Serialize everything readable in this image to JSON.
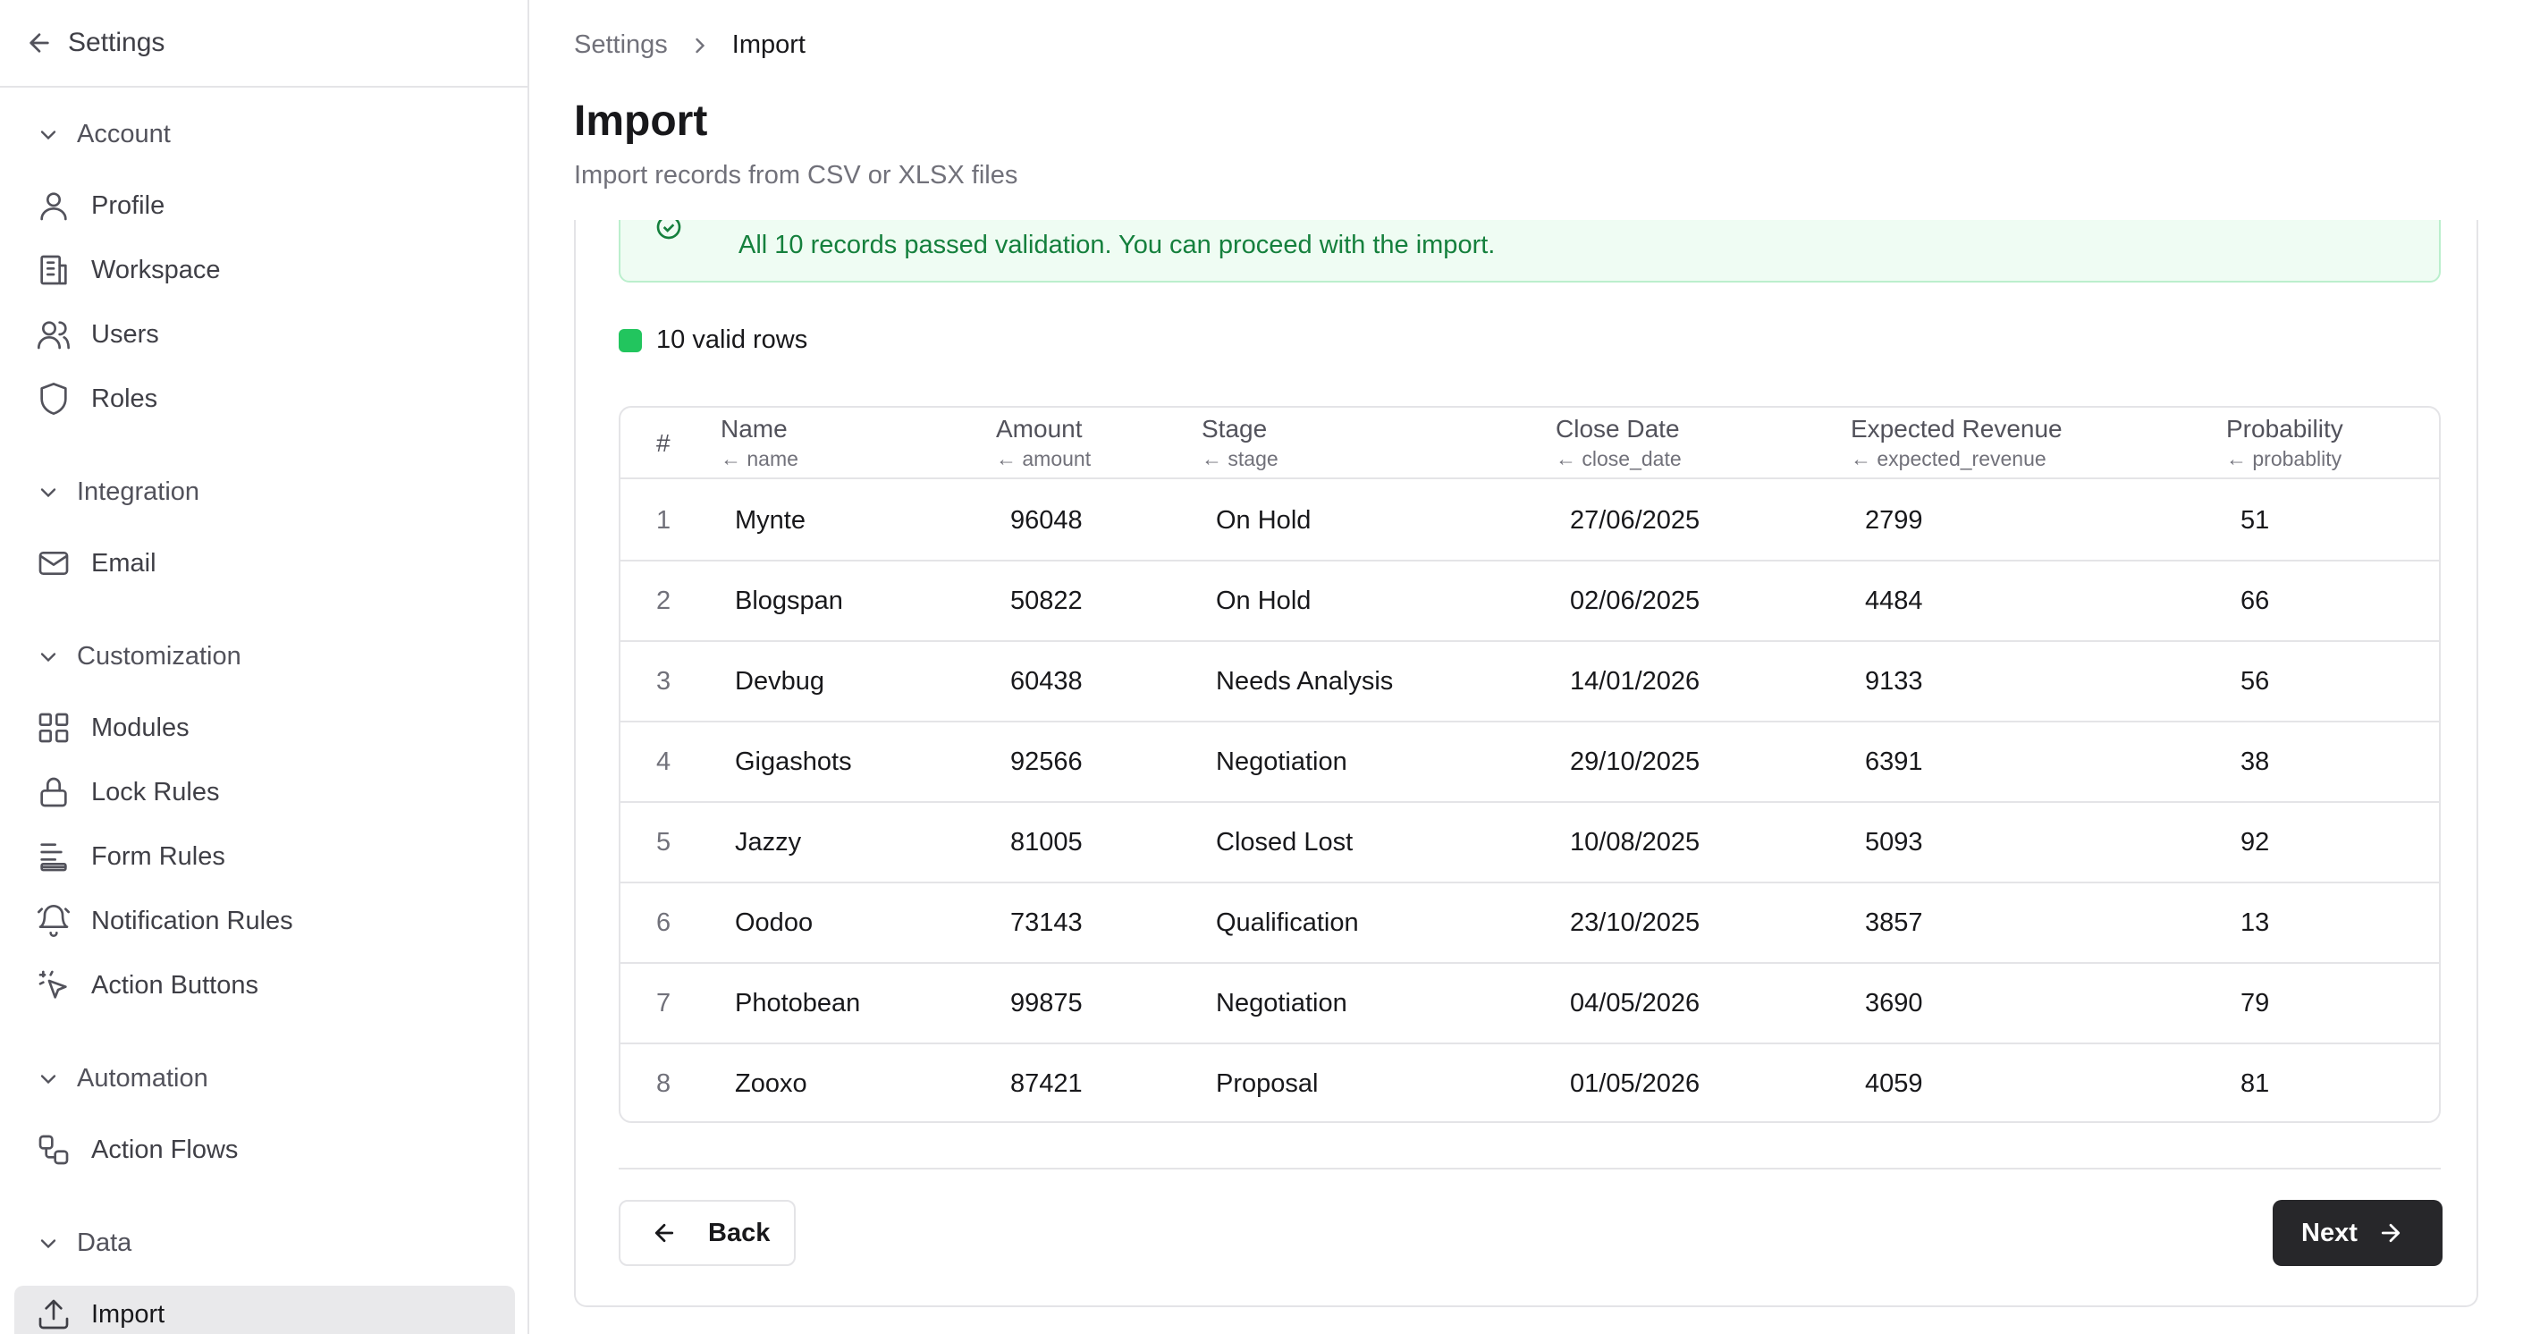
{
  "sidebar": {
    "back_label": "Settings",
    "groups": [
      {
        "title": "Account",
        "items": [
          {
            "label": "Profile",
            "icon": "user-icon"
          },
          {
            "label": "Workspace",
            "icon": "building-icon"
          },
          {
            "label": "Users",
            "icon": "users-icon"
          },
          {
            "label": "Roles",
            "icon": "shield-icon"
          }
        ]
      },
      {
        "title": "Integration",
        "items": [
          {
            "label": "Email",
            "icon": "mail-icon"
          }
        ]
      },
      {
        "title": "Customization",
        "items": [
          {
            "label": "Modules",
            "icon": "grid-icon"
          },
          {
            "label": "Lock Rules",
            "icon": "lock-icon"
          },
          {
            "label": "Form Rules",
            "icon": "align-left-icon"
          },
          {
            "label": "Notification Rules",
            "icon": "bell-icon"
          },
          {
            "label": "Action Buttons",
            "icon": "pointer-click-icon"
          }
        ]
      },
      {
        "title": "Automation",
        "items": [
          {
            "label": "Action Flows",
            "icon": "workflow-icon"
          }
        ]
      },
      {
        "title": "Data",
        "items": [
          {
            "label": "Import",
            "icon": "upload-icon",
            "active": true
          }
        ]
      }
    ]
  },
  "breadcrumb": {
    "parent": "Settings",
    "current": "Import"
  },
  "page": {
    "title": "Import",
    "subtitle": "Import records from CSV or XLSX files"
  },
  "alert": {
    "message": "All 10 records passed validation. You can proceed with the import.",
    "color": "#15803d"
  },
  "valid": {
    "label": "10 valid rows",
    "color": "#22c55e"
  },
  "table": {
    "hash": "#",
    "columns": [
      {
        "title": "Name",
        "source": "name"
      },
      {
        "title": "Amount",
        "source": "amount"
      },
      {
        "title": "Stage",
        "source": "stage"
      },
      {
        "title": "Close Date",
        "source": "close_date"
      },
      {
        "title": "Expected Revenue",
        "source": "expected_revenue"
      },
      {
        "title": "Probability",
        "source": "probablity"
      }
    ],
    "rows": [
      [
        "1",
        "Mynte",
        "96048",
        "On Hold",
        "27/06/2025",
        "2799",
        "51"
      ],
      [
        "2",
        "Blogspan",
        "50822",
        "On Hold",
        "02/06/2025",
        "4484",
        "66"
      ],
      [
        "3",
        "Devbug",
        "60438",
        "Needs Analysis",
        "14/01/2026",
        "9133",
        "56"
      ],
      [
        "4",
        "Gigashots",
        "92566",
        "Negotiation",
        "29/10/2025",
        "6391",
        "38"
      ],
      [
        "5",
        "Jazzy",
        "81005",
        "Closed Lost",
        "10/08/2025",
        "5093",
        "92"
      ],
      [
        "6",
        "Oodoo",
        "73143",
        "Qualification",
        "23/10/2025",
        "3857",
        "13"
      ],
      [
        "7",
        "Photobean",
        "99875",
        "Negotiation",
        "04/05/2026",
        "3690",
        "79"
      ],
      [
        "8",
        "Zooxo",
        "87421",
        "Proposal",
        "01/05/2026",
        "4059",
        "81"
      ]
    ]
  },
  "footer": {
    "back_label": "Back",
    "next_label": "Next"
  }
}
